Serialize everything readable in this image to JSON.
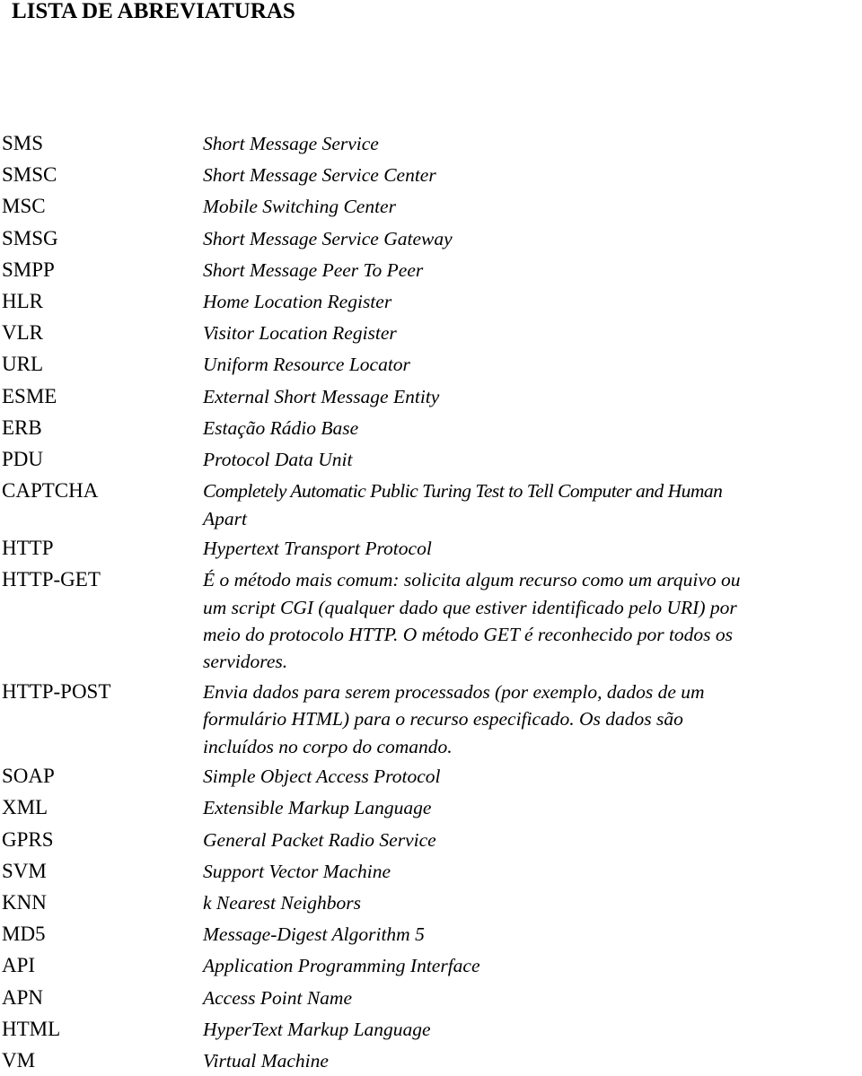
{
  "title": "LISTA DE ABREVIATURAS",
  "entries": [
    {
      "abbr": "SMS",
      "def": "Short Message Service"
    },
    {
      "abbr": "SMSC",
      "def": "Short Message Service Center"
    },
    {
      "abbr": "MSC",
      "def": "Mobile Switching Center"
    },
    {
      "abbr": "SMSG",
      "def": "Short Message Service Gateway"
    },
    {
      "abbr": "SMPP",
      "def": "Short Message Peer To Peer"
    },
    {
      "abbr": "HLR",
      "def": "Home Location Register"
    },
    {
      "abbr": "VLR",
      "def": "Visitor Location Register"
    },
    {
      "abbr": "URL",
      "def": "Uniform Resource Locator"
    },
    {
      "abbr": "ESME",
      "def": "External Short Message Entity"
    },
    {
      "abbr": "ERB",
      "def": "Estação Rádio Base"
    },
    {
      "abbr": "PDU",
      "def": "Protocol Data Unit"
    },
    {
      "abbr": "CAPTCHA",
      "def_lines": [
        "Completely Automatic Public Turing Test to Tell Computer and Human",
        "Apart"
      ]
    },
    {
      "abbr": "HTTP",
      "def": "Hypertext Transport Protocol"
    },
    {
      "abbr": "HTTP-GET",
      "def_lines": [
        "É o método mais comum: solicita algum recurso como um arquivo ou",
        "um script CGI (qualquer dado que estiver identificado pelo URI) por",
        "meio do protocolo HTTP. O método GET é reconhecido por todos os",
        "servidores."
      ]
    },
    {
      "abbr": "HTTP-POST",
      "def_lines": [
        "Envia dados para serem processados (por exemplo, dados de um",
        "formulário HTML) para o recurso especificado. Os dados são",
        "incluídos no corpo do comando."
      ]
    },
    {
      "abbr": "SOAP",
      "def": "Simple Object Access Protocol"
    },
    {
      "abbr": "XML",
      "def": "Extensible Markup Language"
    },
    {
      "abbr": "GPRS",
      "def": "General Packet Radio Service"
    },
    {
      "abbr": "SVM",
      "def": "Support Vector Machine"
    },
    {
      "abbr": "KNN",
      "def": "k Nearest Neighbors"
    },
    {
      "abbr": "MD5",
      "def": "Message-Digest Algorithm 5"
    },
    {
      "abbr": "API",
      "def": "Application Programming Interface"
    },
    {
      "abbr": "APN",
      "def": "Access Point Name"
    },
    {
      "abbr": "HTML",
      "def": "HyperText Markup Language"
    },
    {
      "abbr": "VM",
      "def": "Virtual Machine"
    }
  ]
}
